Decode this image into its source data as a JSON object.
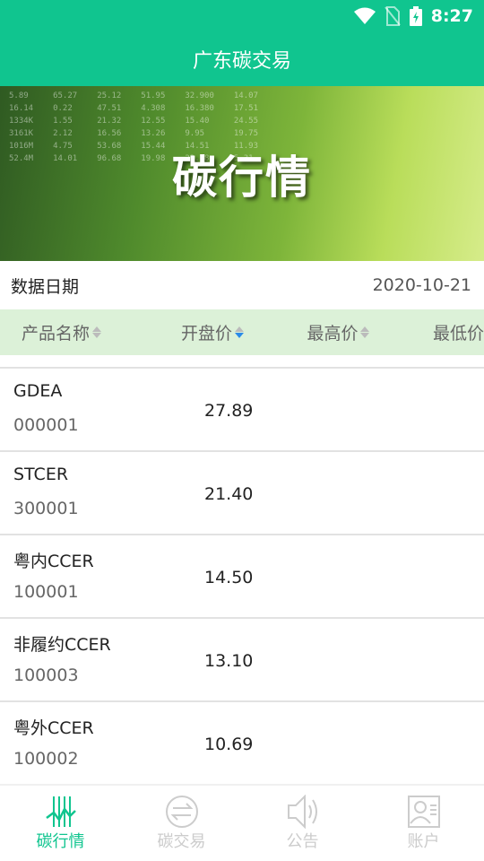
{
  "status": {
    "time": "8:27",
    "icons": [
      "wifi-icon",
      "no-sim-icon",
      "battery-charging-icon"
    ]
  },
  "header": {
    "title": "广东碳交易"
  },
  "banner": {
    "title": "碳行情"
  },
  "date": {
    "label": "数据日期",
    "value": "2020-10-21"
  },
  "table": {
    "columns": [
      {
        "label": "产品名称",
        "sort": "none"
      },
      {
        "label": "开盘价",
        "sort": "desc"
      },
      {
        "label": "最高价",
        "sort": "none"
      },
      {
        "label": "最低价",
        "sort": "none"
      }
    ],
    "rows": [
      {
        "name": "GDEA",
        "code": "000001",
        "open": "27.89"
      },
      {
        "name": "STCER",
        "code": "300001",
        "open": "21.40"
      },
      {
        "name": "粤内CCER",
        "code": "100001",
        "open": "14.50"
      },
      {
        "name": "非履约CCER",
        "code": "100003",
        "open": "13.10"
      },
      {
        "name": "粤外CCER",
        "code": "100002",
        "open": "10.69"
      }
    ]
  },
  "nav": [
    {
      "label": "碳行情",
      "icon": "market-chart-icon",
      "active": true
    },
    {
      "label": "碳交易",
      "icon": "exchange-icon"
    },
    {
      "label": "公告",
      "icon": "speaker-icon"
    },
    {
      "label": "账户",
      "icon": "account-card-icon"
    }
  ],
  "colors": {
    "primary": "#10c58f",
    "header_bg": "#dcf1d8",
    "sort_active": "#2b8be8"
  }
}
